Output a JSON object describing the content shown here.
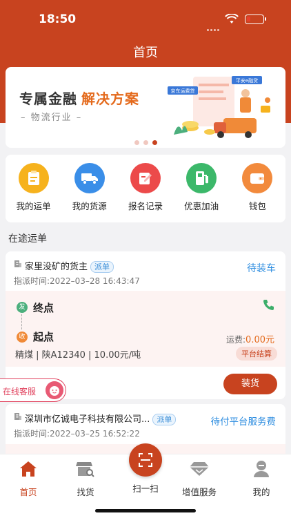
{
  "status_bar": {
    "time": "18:50"
  },
  "page_title": "首页",
  "banner": {
    "title_a": "专属金融",
    "title_b": "解决方案",
    "subtitle": "– 物流行业 –",
    "art_tag1": "京东运费贷",
    "art_tag2": "平安e融贷"
  },
  "quick_menu": [
    {
      "label": "我的运单",
      "color": "#f6b21d"
    },
    {
      "label": "我的货源",
      "color": "#3a8ee8"
    },
    {
      "label": "报名记录",
      "color": "#ec4a4a"
    },
    {
      "label": "优惠加油",
      "color": "#3cb86a"
    },
    {
      "label": "钱包",
      "color": "#f28a3c"
    }
  ],
  "section_title": "在途运单",
  "order1": {
    "shipper": "家里没矿的货主",
    "tag": "派单",
    "status": "待装车",
    "time": "指派时间:2022–03–28 16:43:47",
    "end_label": "终点",
    "start_label": "起点",
    "fa": "发",
    "shou": "收",
    "fee_label": "运费:",
    "fee_value": "0.00元",
    "goods": "精煤 | 陕A12340 | 10.00元/吨",
    "settle": "平台结算",
    "action": "装货"
  },
  "order2": {
    "shipper": "深圳市亿诚电子科技有限公司...",
    "tag": "派单",
    "status": "待付平台服务费",
    "time": "指派时间:2022–03–25 16:52:22"
  },
  "kefu": "在线客服",
  "tabs": {
    "home": "首页",
    "find": "找货",
    "scan": "扫一扫",
    "vas": "增值服务",
    "mine": "我的"
  }
}
